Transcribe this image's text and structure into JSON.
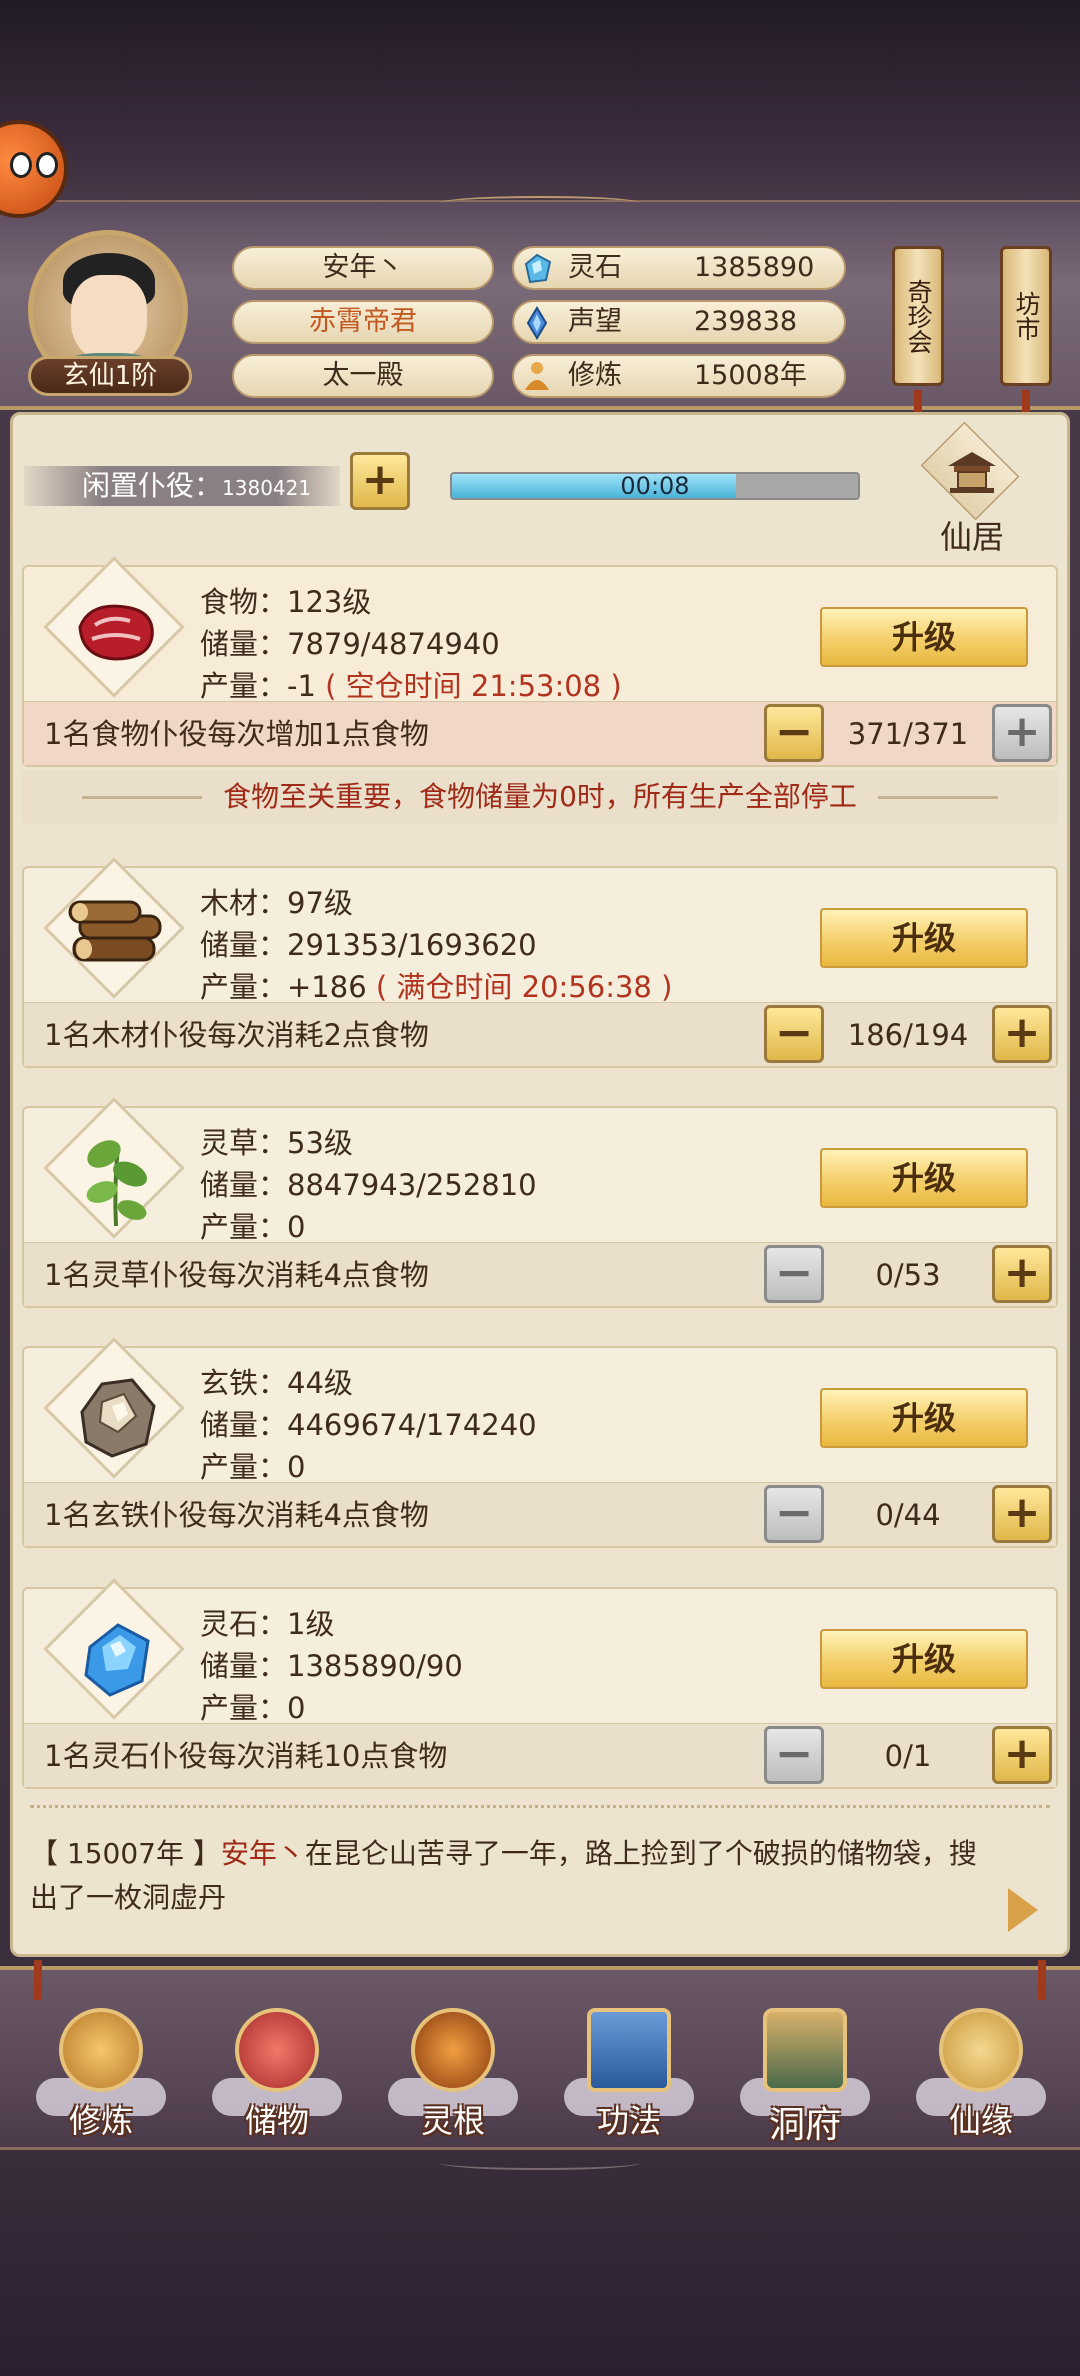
{
  "player": {
    "name": "安年丶",
    "title": "赤霄帝君",
    "sect": "太一殿",
    "rank": "玄仙1阶"
  },
  "stats": [
    {
      "label": "灵石",
      "value": "1385890",
      "icon": "spirit-stone-icon"
    },
    {
      "label": "声望",
      "value": "239838",
      "icon": "prestige-crystal-icon"
    },
    {
      "label": "修炼",
      "value": "15008年",
      "icon": "cultivation-figure-icon"
    }
  ],
  "side_buttons": {
    "treasure_fair": "奇珍会",
    "market": "坊市"
  },
  "idle": {
    "label": "闲置仆役：",
    "count": "1380421",
    "timer": "00:08",
    "progress": 0.7
  },
  "residence_label": "仙居",
  "upgrade_label": "升级",
  "resources": [
    {
      "level": "食物：123级",
      "storage": "储量：7879/4874940",
      "output": "产量：-1",
      "output_note": "( 空仓时间 21:53:08 )",
      "desc": "1名食物仆役每次增加1点食物",
      "workers": "371/371",
      "icon": "meat-icon"
    },
    {
      "level": "木材：97级",
      "storage": "储量：291353/1693620",
      "output": "产量：+186",
      "output_note": "( 满仓时间 20:56:38 )",
      "desc": "1名木材仆役每次消耗2点食物",
      "workers": "186/194",
      "icon": "wood-logs-icon"
    },
    {
      "level": "灵草：53级",
      "storage": "储量：8847943/252810",
      "output": "产量：0",
      "output_note": "",
      "desc": "1名灵草仆役每次消耗4点食物",
      "workers": "0/53",
      "icon": "spirit-herb-icon"
    },
    {
      "level": "玄铁：44级",
      "storage": "储量：4469674/174240",
      "output": "产量：0",
      "output_note": "",
      "desc": "1名玄铁仆役每次消耗4点食物",
      "workers": "0/44",
      "icon": "black-iron-ore-icon"
    },
    {
      "level": "灵石：1级",
      "storage": "储量：1385890/90",
      "output": "产量：0",
      "output_note": "",
      "desc": "1名灵石仆役每次消耗10点食物",
      "workers": "0/1",
      "icon": "spirit-crystal-icon"
    }
  ],
  "warning": "食物至关重要，食物储量为0时，所有生产全部停工",
  "log": {
    "year": "【 15007年 】",
    "name": "安年丶",
    "text": "在昆仑山苦寻了一年，路上捡到了个破损的储物袋，搜出了一枚洞虚丹"
  },
  "nav": [
    {
      "label": "修炼",
      "icon": "monk-icon"
    },
    {
      "label": "储物",
      "icon": "pouch-icon"
    },
    {
      "label": "灵根",
      "icon": "spirit-root-icon"
    },
    {
      "label": "功法",
      "icon": "scripture-book-icon"
    },
    {
      "label": "洞府",
      "icon": "cave-house-icon"
    },
    {
      "label": "仙缘",
      "icon": "gourd-icon"
    }
  ],
  "colors": {
    "accent_red": "#b2331e",
    "button_gold": "#f4cf6a",
    "panel_bg": "#ede4d0",
    "header_bg": "#6a5866"
  }
}
